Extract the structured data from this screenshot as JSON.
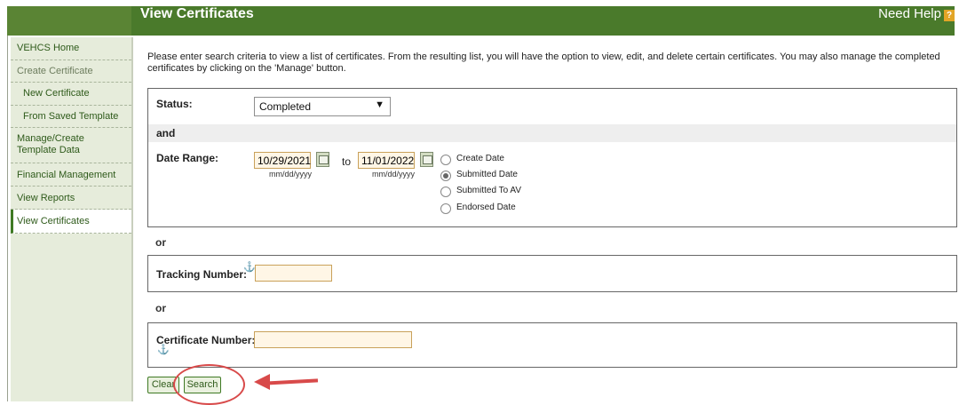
{
  "header": {
    "title": "View Certificates",
    "help_label": "Need Help",
    "help_icon_text": "?"
  },
  "sidebar": {
    "items": [
      {
        "label": "VEHCS Home"
      },
      {
        "label": "Create Certificate"
      },
      {
        "label": "New Certificate"
      },
      {
        "label": "From Saved Template"
      },
      {
        "label": "Manage/Create\nTemplate Data"
      },
      {
        "label": "Financial Management"
      },
      {
        "label": "View Reports"
      },
      {
        "label": "View Certificates"
      }
    ]
  },
  "intro": "Please enter search criteria to view a list of certificates. From the resulting list, you will have the option to view, edit, and delete certain certificates. You may also manage the completed certificates by clicking on the 'Manage' button.",
  "status": {
    "label": "Status:",
    "value": "Completed"
  },
  "and_label": "and",
  "date_range": {
    "label": "Date Range:",
    "from_value": "10/29/2021",
    "to_label": "to",
    "to_value": "11/01/2022",
    "format_hint": "mm/dd/yyyy",
    "options": [
      {
        "label": "Create Date",
        "selected": false
      },
      {
        "label": "Submitted Date",
        "selected": true
      },
      {
        "label": "Submitted To AV",
        "selected": false
      },
      {
        "label": "Endorsed Date",
        "selected": false
      }
    ]
  },
  "or_label": "or",
  "tracking": {
    "label": "Tracking Number:",
    "value": ""
  },
  "certificate": {
    "label": "Certificate Number:",
    "value": ""
  },
  "buttons": {
    "clear": "Clear",
    "search": "Search"
  },
  "colors": {
    "header_green": "#4a7a2b",
    "sidebar_bg": "#e6ecdb",
    "annotation_red": "#d84a4a",
    "input_bg": "#fff6e6"
  }
}
